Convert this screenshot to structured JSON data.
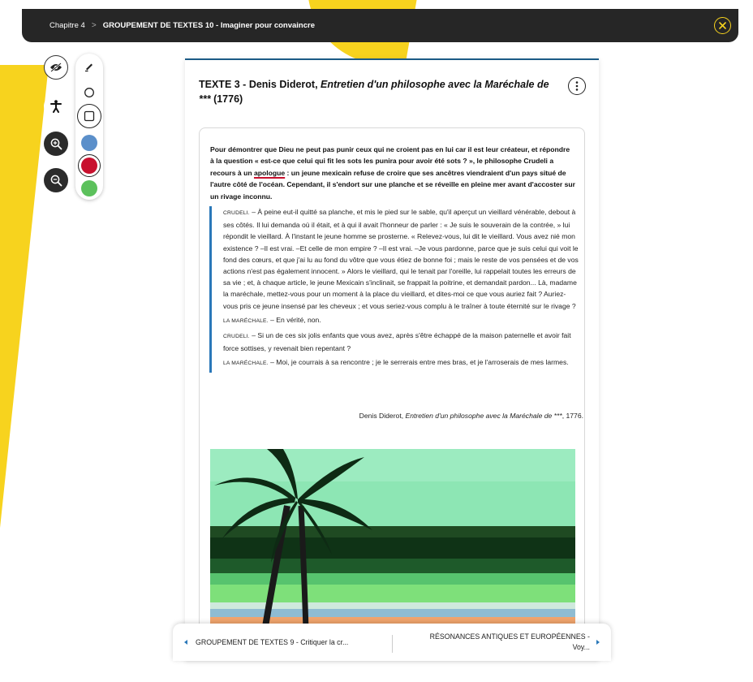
{
  "breadcrumb": {
    "chapter": "Chapitre 4",
    "separator": ">",
    "section": "GROUPEMENT DE TEXTES 10 - Imaginer pour convaincre"
  },
  "icons": {
    "close": "close-circle-icon",
    "hide": "eye-slash-icon",
    "accessibility": "accessibility-person-icon",
    "zoom_in": "zoom-in-icon",
    "zoom_out": "zoom-out-icon",
    "pen": "pen-icon",
    "circle": "circle-shape-icon",
    "square": "square-shape-icon",
    "more": "more-vertical-icon"
  },
  "palette": {
    "colors": [
      "#5b8fca",
      "#c8102e",
      "#5cc15c"
    ],
    "selected": "#c8102e"
  },
  "colors": {
    "accent": "#f7d31e",
    "topbar": "#262626",
    "card_border": "#1c5b86",
    "quote_bar": "#2a78b9"
  },
  "text": {
    "title_prefix": "TEXTE 3 - Denis Diderot, ",
    "title_work": "Entretien d'un philosophe avec la Maréchale de ***",
    "title_suffix": " (1776)",
    "intro_before": "Pour démontrer que Dieu ne peut pas punir ceux qui ne croient pas en lui car il est leur créateur, et répondre à la question « est-ce que celui qui fit les sots les punira pour avoir été sots ? », le philosophe Crudeli a recours à un ",
    "intro_keyword": "apologue",
    "intro_after": " : un jeune mexicain refuse de croire que ses ancêtres viendraient d'un pays situé de l'autre côté de l'océan. Cependant, il s'endort sur une planche et se réveille en pleine mer avant d'accoster sur un rivage inconnu.",
    "speaker_crudeli": "Crudeli.",
    "speaker_marechale": "La Maréchale.",
    "p1": " – À peine eut-il quitté sa planche, et mis le pied sur le sable, qu'il aperçut un vieillard vénérable, debout à ses côtés. Il lui demanda où il était, et à qui il avait l'honneur de parler : « Je suis le souverain de la contrée, » lui répondit le vieillard. À l'instant le jeune homme se prosterne. « Relevez-vous, lui dit le vieillard. Vous avez nié mon existence ? –Il est vrai. –Et celle de mon empire ? –Il est vrai. –Je vous pardonne, parce que je suis celui qui voit le fond des cœurs, et que j'ai lu au fond du vôtre que vous étiez de bonne foi ; mais le reste de vos pensées et de vos actions n'est pas également innocent. » Alors le vieillard, qui le tenait par l'oreille, lui rappelait toutes les erreurs de sa vie ; et, à chaque article, le jeune Mexicain s'inclinait, se frappait la poitrine, et demandait pardon... Là, madame la maréchale, mettez-vous pour un moment à la place du vieillard, et dites-moi ce que vous auriez fait ? Auriez-vous pris ce jeune insensé par les cheveux ; et vous seriez-vous complu à le traîner à toute éternité sur le rivage ?",
    "p2": " – En vérité, non.",
    "p3": " – Si un de ces six jolis enfants que vous avez, après s'être échappé de la maison paternelle et avoir fait force sottises, y revenait bien repentant ?",
    "p4": " – Moi, je courrais à sa rencontre ; je le serrerais entre mes bras, et je l'arroserais de mes larmes.",
    "sig_author": "Denis Diderot, ",
    "sig_work": "Entretien d'un philosophe avec la Maréchale de ***",
    "sig_year": ", 1776."
  },
  "nav": {
    "prev_label": "GROUPEMENT DE TEXTES 9 - Critiquer la cr...",
    "next_label_line1": "RÉSONANCES ANTIQUES ET EUROPÉENNES -",
    "next_label_line2": "Voy..."
  }
}
